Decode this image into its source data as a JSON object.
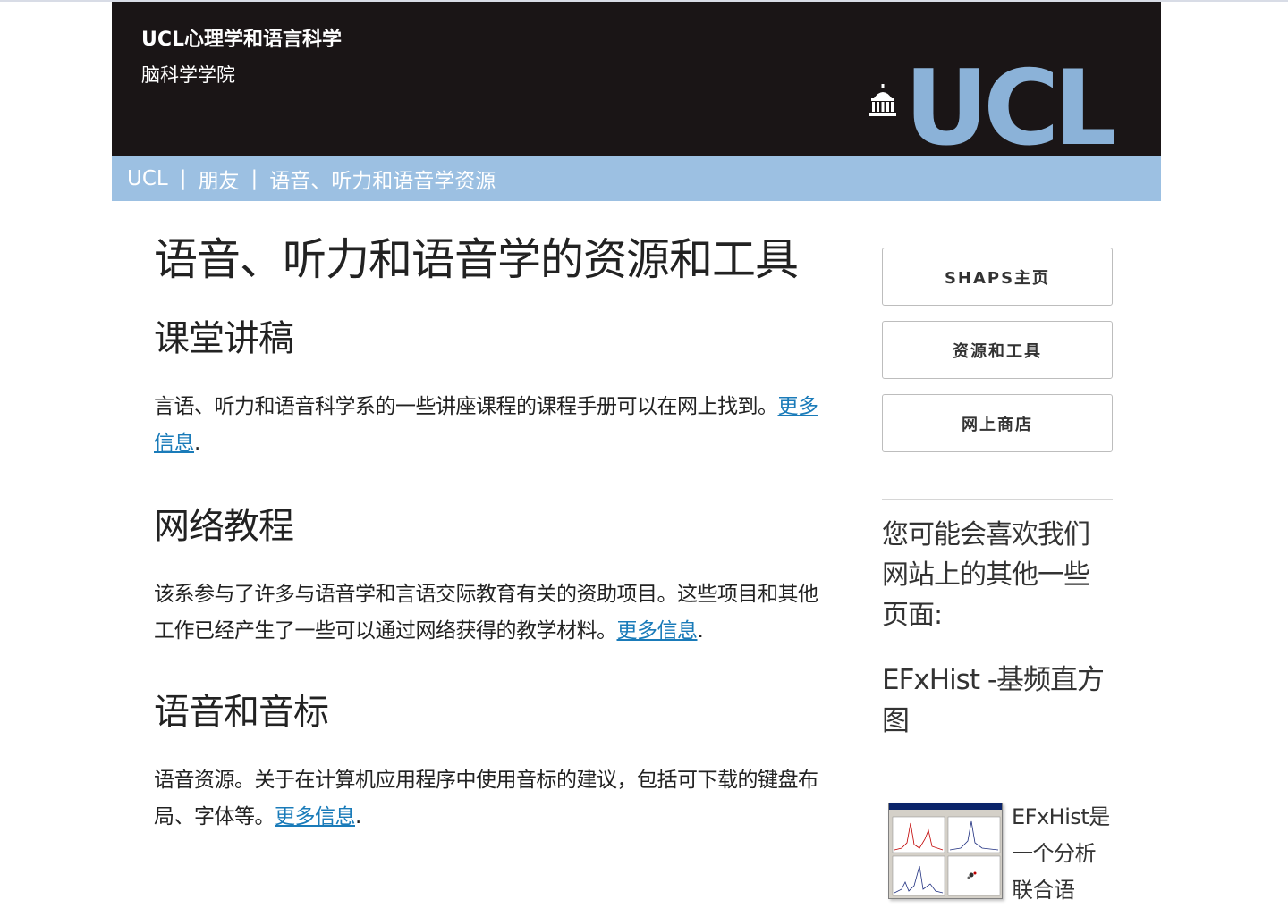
{
  "masthead": {
    "title": "UCL心理学和语言科学",
    "subtitle": "脑科学学院",
    "logo_text": "UCL",
    "logo_color": "#8bb2d8"
  },
  "breadcrumb": {
    "items": [
      "UCL",
      "朋友",
      "语音、听力和语音学资源"
    ],
    "separator": "|"
  },
  "main": {
    "title": "语音、听力和语音学的资源和工具",
    "sections": [
      {
        "heading": "课堂讲稿",
        "text": "言语、听力和语音科学系的一些讲座课程的课程手册可以在网上找到。",
        "link": "更多信息",
        "suffix": "."
      },
      {
        "heading": "网络教程",
        "text": "该系参与了许多与语音学和言语交际教育有关的资助项目。这些项目和其他工作已经产生了一些可以通过网络获得的教学材料。",
        "link": "更多信息",
        "suffix": "."
      },
      {
        "heading": "语音和音标",
        "text": "语音资源。关于在计算机应用程序中使用音标的建议，包括可下载的键盘布局、字体等。",
        "link": "更多信息",
        "suffix": "."
      }
    ]
  },
  "sidebar": {
    "buttons": [
      "SHAPS主页",
      "资源和工具",
      "网上商店"
    ],
    "intro": "您可能会喜欢我们网站上的其他一些页面:",
    "link_title": "EFxHist -基频直方图",
    "caption": "EFxHist是一个分析联合语"
  },
  "colors": {
    "masthead_bg": "#1a1516",
    "breadcrumb_bg": "#9cc0e2",
    "link": "#1a7bb9"
  }
}
